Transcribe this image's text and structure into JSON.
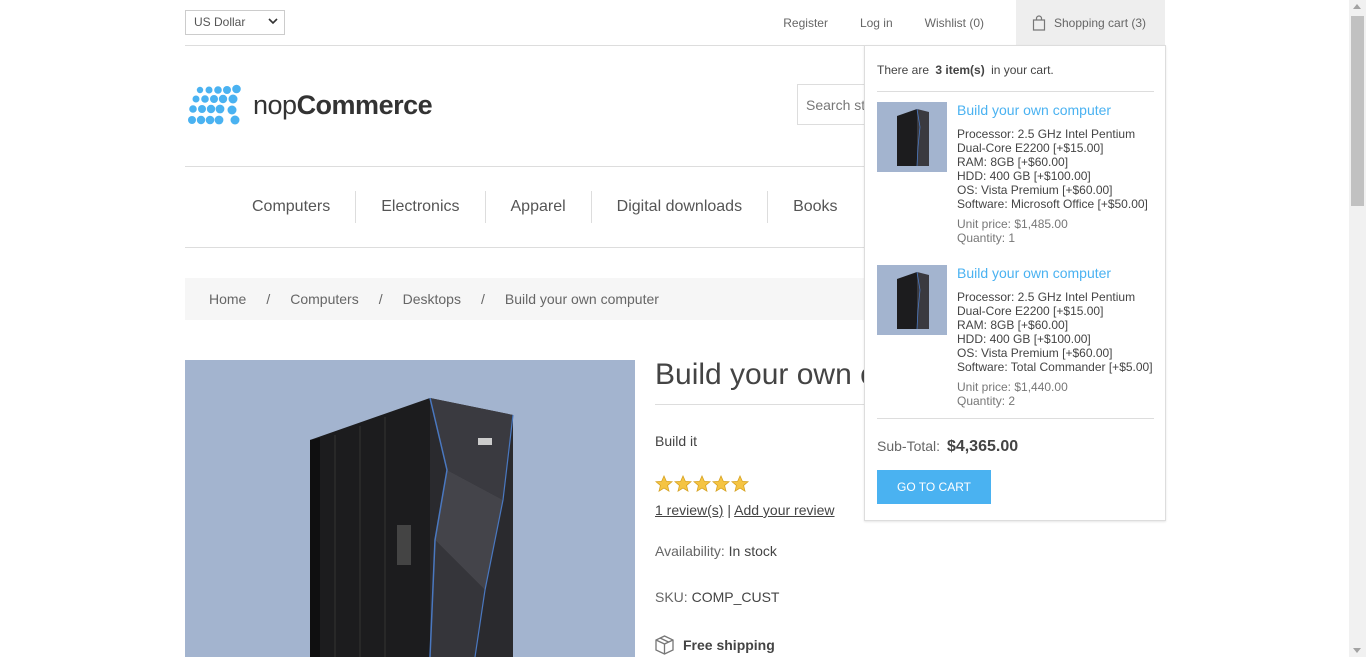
{
  "header": {
    "currency": "US Dollar",
    "register": "Register",
    "login": "Log in",
    "wishlist": "Wishlist (0)",
    "cart": "Shopping cart (3)"
  },
  "logo": {
    "prefix": "nop",
    "brand": "Commerce"
  },
  "search": {
    "placeholder": "Search st"
  },
  "menu": {
    "items": [
      "Computers",
      "Electronics",
      "Apparel",
      "Digital downloads",
      "Books"
    ]
  },
  "breadcrumb": {
    "items": [
      "Home",
      "Computers",
      "Desktops",
      "Build your own computer"
    ],
    "separator": "/"
  },
  "product": {
    "title": "Build your own c",
    "short_description": "Build it",
    "rating_stars": 5,
    "reviews_link": "1 review(s)",
    "review_separator": "|",
    "add_review_link": "Add your review",
    "availability_label": "Availability:",
    "availability_value": "In stock",
    "sku_label": "SKU:",
    "sku_value": "COMP_CUST",
    "free_shipping": "Free shipping"
  },
  "flyout_cart": {
    "count_prefix": "There are",
    "count_value": "3 item(s)",
    "count_suffix": "in your cart.",
    "items": [
      {
        "name": "Build your own computer",
        "attributes": [
          "Processor: 2.5 GHz Intel Pentium Dual-Core E2200 [+$15.00]",
          "RAM: 8GB [+$60.00]",
          "HDD: 400 GB [+$100.00]",
          "OS: Vista Premium [+$60.00]",
          "Software: Microsoft Office [+$50.00]"
        ],
        "unit_price": "Unit price: $1,485.00",
        "quantity": "Quantity: 1"
      },
      {
        "name": "Build your own computer",
        "attributes": [
          "Processor: 2.5 GHz Intel Pentium Dual-Core E2200 [+$15.00]",
          "RAM: 8GB [+$60.00]",
          "HDD: 400 GB [+$100.00]",
          "OS: Vista Premium [+$60.00]",
          "Software: Total Commander [+$5.00]"
        ],
        "unit_price": "Unit price: $1,440.00",
        "quantity": "Quantity: 2"
      }
    ],
    "subtotal_label": "Sub-Total:",
    "subtotal_value": "$4,365.00",
    "go_to_cart": "GO TO CART"
  },
  "colors": {
    "accent": "#4ab2f1",
    "logo": "#4ab2f1",
    "product_bg": "#a3b4cf"
  },
  "icons": [
    "chevron-down-icon",
    "shopping-bag-icon",
    "star-icon",
    "box-icon"
  ]
}
